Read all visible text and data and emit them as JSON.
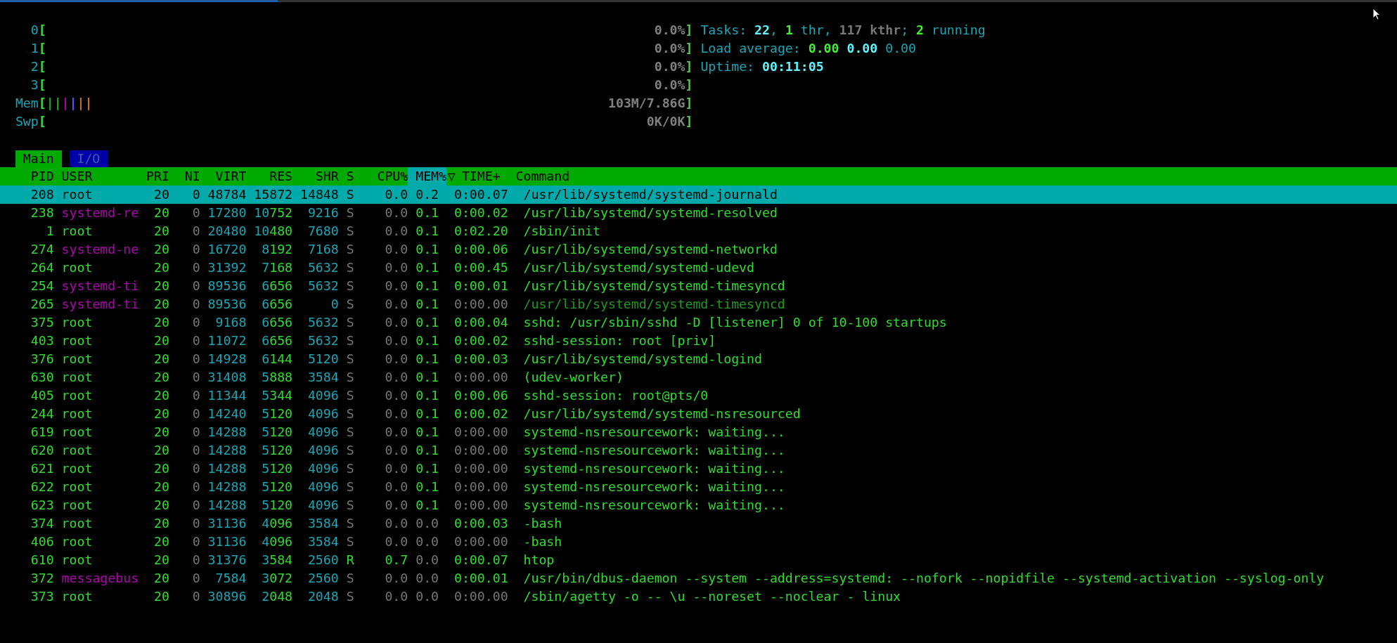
{
  "meters": [
    {
      "kind": "bar",
      "label": "0",
      "open": "[",
      "close": "]",
      "value": "0.0%"
    },
    {
      "kind": "bar",
      "label": "1",
      "open": "[",
      "close": "]",
      "value": "0.0%"
    },
    {
      "kind": "bar",
      "label": "2",
      "open": "[",
      "close": "]",
      "value": "0.0%"
    },
    {
      "kind": "bar",
      "label": "3",
      "open": "[",
      "close": "]",
      "value": "0.0%"
    },
    {
      "kind": "segments",
      "label": "Mem",
      "open": "[",
      "close": "]",
      "segments": [
        {
          "text": "|",
          "color": "#22aa22"
        },
        {
          "text": "|",
          "color": "#22aa22"
        },
        {
          "text": "|",
          "color": "#aa00aa"
        },
        {
          "text": "|",
          "color": "#5555ff"
        },
        {
          "text": "|",
          "color": "#c86f1e"
        },
        {
          "text": "|",
          "color": "#c86f1e"
        }
      ],
      "value": "103M/7.86G"
    },
    {
      "kind": "bar",
      "label": "Swp",
      "open": "[",
      "close": "]",
      "value": "0K/0K"
    }
  ],
  "summary": [
    [
      {
        "text": "Tasks: ",
        "kind": "label"
      },
      {
        "text": "22",
        "kind": "bright"
      },
      {
        "text": ", ",
        "kind": "label"
      },
      {
        "text": "1",
        "kind": "green"
      },
      {
        "text": " thr, ",
        "kind": "label"
      },
      {
        "text": "117 kthr",
        "kind": "grey"
      },
      {
        "text": "; ",
        "kind": "label"
      },
      {
        "text": "2",
        "kind": "green"
      },
      {
        "text": " running",
        "kind": "label"
      }
    ],
    [
      {
        "text": "Load average: ",
        "kind": "label"
      },
      {
        "text": "0.00 ",
        "kind": "green"
      },
      {
        "text": "0.00 ",
        "kind": "bright"
      },
      {
        "text": "0.00",
        "kind": "label"
      }
    ],
    [
      {
        "text": "Uptime: ",
        "kind": "label"
      },
      {
        "text": "00:11:05",
        "kind": "bright"
      }
    ]
  ],
  "tabs": [
    {
      "label": "Main",
      "selected": true
    },
    {
      "label": "I/O",
      "selected": false
    }
  ],
  "header": {
    "columns": [
      {
        "label": "PID",
        "sorted": false
      },
      {
        "label": "USER",
        "sorted": false
      },
      {
        "label": "PRI",
        "sorted": false
      },
      {
        "label": "NI",
        "sorted": false
      },
      {
        "label": "VIRT",
        "sorted": false
      },
      {
        "label": "RES",
        "sorted": false
      },
      {
        "label": "SHR",
        "sorted": false
      },
      {
        "label": "S",
        "sorted": false
      },
      {
        "label": "CPU%",
        "sorted": false
      },
      {
        "label": "MEM%",
        "sorted": true
      },
      {
        "label": "TIME+",
        "sorted": false
      },
      {
        "label": "Command",
        "sorted": false
      }
    ],
    "sort_indicator": "▽"
  },
  "rows": [
    {
      "pid": "208",
      "user": "root",
      "pri": "20",
      "ni": "0",
      "virt": "48784",
      "res": "15872",
      "shr": "14848",
      "s": "S",
      "cpu": "0.0",
      "mem": "0.2",
      "time": "0:00.07",
      "command": "/usr/lib/systemd/systemd-journald",
      "selected": true,
      "system_user": false,
      "running": false,
      "mem_zero": false,
      "time_zero": false,
      "thread": false
    },
    {
      "pid": "238",
      "user": "systemd-re",
      "pri": "20",
      "ni": "0",
      "virt": "17280",
      "res": "10752",
      "shr": "9216",
      "s": "S",
      "cpu": "0.0",
      "mem": "0.1",
      "time": "0:00.02",
      "command": "/usr/lib/systemd/systemd-resolved",
      "selected": false,
      "system_user": true,
      "running": false,
      "mem_zero": false,
      "time_zero": false,
      "thread": false
    },
    {
      "pid": "1",
      "user": "root",
      "pri": "20",
      "ni": "0",
      "virt": "20480",
      "res": "10480",
      "shr": "7680",
      "s": "S",
      "cpu": "0.0",
      "mem": "0.1",
      "time": "0:02.20",
      "command": "/sbin/init",
      "selected": false,
      "system_user": false,
      "running": false,
      "mem_zero": false,
      "time_zero": false,
      "thread": false
    },
    {
      "pid": "274",
      "user": "systemd-ne",
      "pri": "20",
      "ni": "0",
      "virt": "16720",
      "res": "8192",
      "shr": "7168",
      "s": "S",
      "cpu": "0.0",
      "mem": "0.1",
      "time": "0:00.06",
      "command": "/usr/lib/systemd/systemd-networkd",
      "selected": false,
      "system_user": true,
      "running": false,
      "mem_zero": false,
      "time_zero": false,
      "thread": false
    },
    {
      "pid": "264",
      "user": "root",
      "pri": "20",
      "ni": "0",
      "virt": "31392",
      "res": "7168",
      "shr": "5632",
      "s": "S",
      "cpu": "0.0",
      "mem": "0.1",
      "time": "0:00.45",
      "command": "/usr/lib/systemd/systemd-udevd",
      "selected": false,
      "system_user": false,
      "running": false,
      "mem_zero": false,
      "time_zero": false,
      "thread": false
    },
    {
      "pid": "254",
      "user": "systemd-ti",
      "pri": "20",
      "ni": "0",
      "virt": "89536",
      "res": "6656",
      "shr": "5632",
      "s": "S",
      "cpu": "0.0",
      "mem": "0.1",
      "time": "0:00.01",
      "command": "/usr/lib/systemd/systemd-timesyncd",
      "selected": false,
      "system_user": true,
      "running": false,
      "mem_zero": false,
      "time_zero": false,
      "thread": false
    },
    {
      "pid": "265",
      "user": "systemd-ti",
      "pri": "20",
      "ni": "0",
      "virt": "89536",
      "res": "6656",
      "shr": "0",
      "s": "S",
      "cpu": "0.0",
      "mem": "0.1",
      "time": "0:00.00",
      "command": "/usr/lib/systemd/systemd-timesyncd",
      "selected": false,
      "system_user": true,
      "running": false,
      "mem_zero": false,
      "time_zero": true,
      "thread": true
    },
    {
      "pid": "375",
      "user": "root",
      "pri": "20",
      "ni": "0",
      "virt": "9168",
      "res": "6656",
      "shr": "5632",
      "s": "S",
      "cpu": "0.0",
      "mem": "0.1",
      "time": "0:00.04",
      "command": "sshd: /usr/sbin/sshd -D [listener] 0 of 10-100 startups",
      "selected": false,
      "system_user": false,
      "running": false,
      "mem_zero": false,
      "time_zero": false,
      "thread": false
    },
    {
      "pid": "403",
      "user": "root",
      "pri": "20",
      "ni": "0",
      "virt": "11072",
      "res": "6656",
      "shr": "5632",
      "s": "S",
      "cpu": "0.0",
      "mem": "0.1",
      "time": "0:00.02",
      "command": "sshd-session: root [priv]",
      "selected": false,
      "system_user": false,
      "running": false,
      "mem_zero": false,
      "time_zero": false,
      "thread": false
    },
    {
      "pid": "376",
      "user": "root",
      "pri": "20",
      "ni": "0",
      "virt": "14928",
      "res": "6144",
      "shr": "5120",
      "s": "S",
      "cpu": "0.0",
      "mem": "0.1",
      "time": "0:00.03",
      "command": "/usr/lib/systemd/systemd-logind",
      "selected": false,
      "system_user": false,
      "running": false,
      "mem_zero": false,
      "time_zero": false,
      "thread": false
    },
    {
      "pid": "630",
      "user": "root",
      "pri": "20",
      "ni": "0",
      "virt": "31408",
      "res": "5888",
      "shr": "3584",
      "s": "S",
      "cpu": "0.0",
      "mem": "0.1",
      "time": "0:00.00",
      "command": "(udev-worker)",
      "selected": false,
      "system_user": false,
      "running": false,
      "mem_zero": false,
      "time_zero": true,
      "thread": false
    },
    {
      "pid": "405",
      "user": "root",
      "pri": "20",
      "ni": "0",
      "virt": "11344",
      "res": "5344",
      "shr": "4096",
      "s": "S",
      "cpu": "0.0",
      "mem": "0.1",
      "time": "0:00.06",
      "command": "sshd-session: root@pts/0",
      "selected": false,
      "system_user": false,
      "running": false,
      "mem_zero": false,
      "time_zero": false,
      "thread": false
    },
    {
      "pid": "244",
      "user": "root",
      "pri": "20",
      "ni": "0",
      "virt": "14240",
      "res": "5120",
      "shr": "4096",
      "s": "S",
      "cpu": "0.0",
      "mem": "0.1",
      "time": "0:00.02",
      "command": "/usr/lib/systemd/systemd-nsresourced",
      "selected": false,
      "system_user": false,
      "running": false,
      "mem_zero": false,
      "time_zero": false,
      "thread": false
    },
    {
      "pid": "619",
      "user": "root",
      "pri": "20",
      "ni": "0",
      "virt": "14288",
      "res": "5120",
      "shr": "4096",
      "s": "S",
      "cpu": "0.0",
      "mem": "0.1",
      "time": "0:00.00",
      "command": "systemd-nsresourcework: waiting...",
      "selected": false,
      "system_user": false,
      "running": false,
      "mem_zero": false,
      "time_zero": true,
      "thread": false
    },
    {
      "pid": "620",
      "user": "root",
      "pri": "20",
      "ni": "0",
      "virt": "14288",
      "res": "5120",
      "shr": "4096",
      "s": "S",
      "cpu": "0.0",
      "mem": "0.1",
      "time": "0:00.00",
      "command": "systemd-nsresourcework: waiting...",
      "selected": false,
      "system_user": false,
      "running": false,
      "mem_zero": false,
      "time_zero": true,
      "thread": false
    },
    {
      "pid": "621",
      "user": "root",
      "pri": "20",
      "ni": "0",
      "virt": "14288",
      "res": "5120",
      "shr": "4096",
      "s": "S",
      "cpu": "0.0",
      "mem": "0.1",
      "time": "0:00.00",
      "command": "systemd-nsresourcework: waiting...",
      "selected": false,
      "system_user": false,
      "running": false,
      "mem_zero": false,
      "time_zero": true,
      "thread": false
    },
    {
      "pid": "622",
      "user": "root",
      "pri": "20",
      "ni": "0",
      "virt": "14288",
      "res": "5120",
      "shr": "4096",
      "s": "S",
      "cpu": "0.0",
      "mem": "0.1",
      "time": "0:00.00",
      "command": "systemd-nsresourcework: waiting...",
      "selected": false,
      "system_user": false,
      "running": false,
      "mem_zero": false,
      "time_zero": true,
      "thread": false
    },
    {
      "pid": "623",
      "user": "root",
      "pri": "20",
      "ni": "0",
      "virt": "14288",
      "res": "5120",
      "shr": "4096",
      "s": "S",
      "cpu": "0.0",
      "mem": "0.1",
      "time": "0:00.00",
      "command": "systemd-nsresourcework: waiting...",
      "selected": false,
      "system_user": false,
      "running": false,
      "mem_zero": false,
      "time_zero": true,
      "thread": false
    },
    {
      "pid": "374",
      "user": "root",
      "pri": "20",
      "ni": "0",
      "virt": "31136",
      "res": "4096",
      "shr": "3584",
      "s": "S",
      "cpu": "0.0",
      "mem": "0.0",
      "time": "0:00.03",
      "command": "-bash",
      "selected": false,
      "system_user": false,
      "running": false,
      "mem_zero": true,
      "time_zero": false,
      "thread": false
    },
    {
      "pid": "406",
      "user": "root",
      "pri": "20",
      "ni": "0",
      "virt": "31136",
      "res": "4096",
      "shr": "3584",
      "s": "S",
      "cpu": "0.0",
      "mem": "0.0",
      "time": "0:00.00",
      "command": "-bash",
      "selected": false,
      "system_user": false,
      "running": false,
      "mem_zero": true,
      "time_zero": true,
      "thread": false
    },
    {
      "pid": "610",
      "user": "root",
      "pri": "20",
      "ni": "0",
      "virt": "31376",
      "res": "3584",
      "shr": "2560",
      "s": "R",
      "cpu": "0.7",
      "mem": "0.0",
      "time": "0:00.07",
      "command": "htop",
      "selected": false,
      "system_user": false,
      "running": true,
      "mem_zero": true,
      "time_zero": false,
      "thread": false
    },
    {
      "pid": "372",
      "user": "messagebus",
      "pri": "20",
      "ni": "0",
      "virt": "7584",
      "res": "3072",
      "shr": "2560",
      "s": "S",
      "cpu": "0.0",
      "mem": "0.0",
      "time": "0:00.01",
      "command": "/usr/bin/dbus-daemon --system --address=systemd: --nofork --nopidfile --systemd-activation --syslog-only",
      "selected": false,
      "system_user": true,
      "running": false,
      "mem_zero": true,
      "time_zero": false,
      "thread": false
    },
    {
      "pid": "373",
      "user": "root",
      "pri": "20",
      "ni": "0",
      "virt": "30896",
      "res": "2048",
      "shr": "2048",
      "s": "S",
      "cpu": "0.0",
      "mem": "0.0",
      "time": "0:00.00",
      "command": "/sbin/agetty -o -- \\u --noreset --noclear - linux",
      "selected": false,
      "system_user": false,
      "running": false,
      "mem_zero": true,
      "time_zero": true,
      "thread": false
    }
  ]
}
